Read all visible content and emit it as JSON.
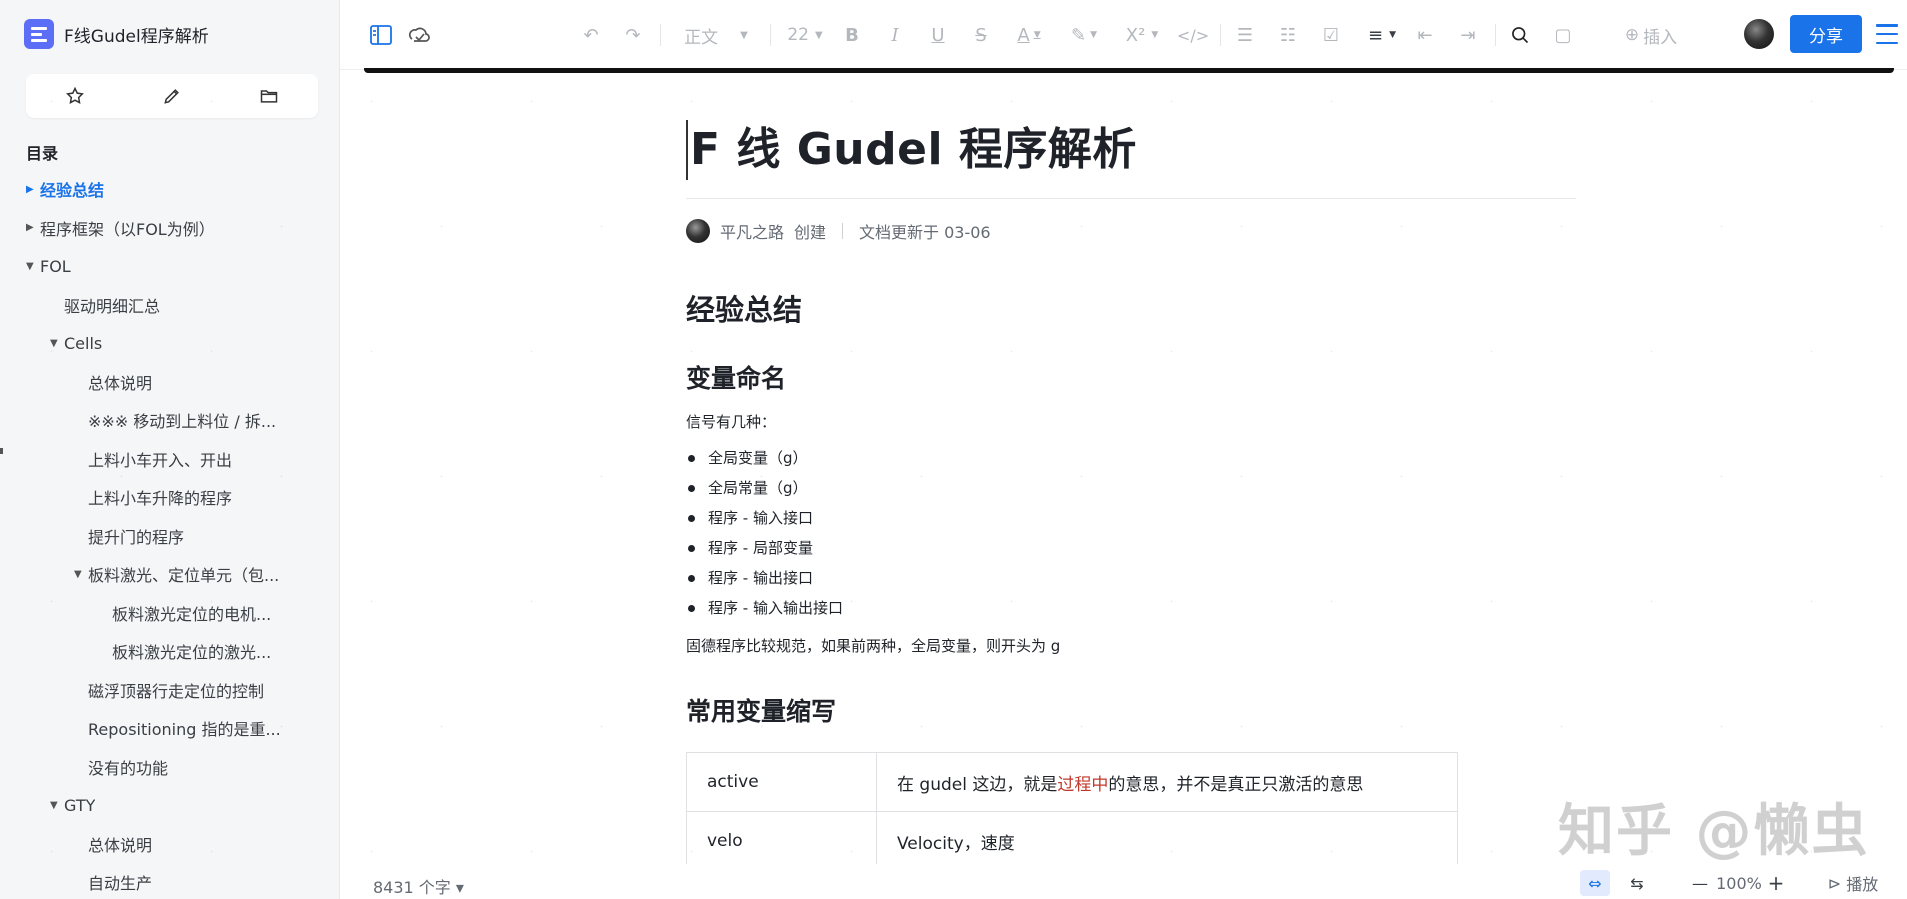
{
  "sidebar": {
    "doc_name": "F线Gudel程序解析",
    "toc_heading": "目录",
    "toc": [
      {
        "label": "经验总结",
        "level": 0,
        "arrow": "▶",
        "active": true
      },
      {
        "label": "程序框架（以FOL为例）",
        "level": 0,
        "arrow": "▶",
        "active": false
      },
      {
        "label": "FOL",
        "level": 0,
        "arrow": "▼",
        "active": false
      },
      {
        "label": "驱动明细汇总",
        "level": 1,
        "arrow": "",
        "active": false
      },
      {
        "label": "Cells",
        "level": 1,
        "arrow": "▼",
        "active": false
      },
      {
        "label": "总体说明",
        "level": 2,
        "arrow": "",
        "active": false
      },
      {
        "label": "※※※ 移动到上料位 / 拆...",
        "level": 2,
        "arrow": "",
        "active": false
      },
      {
        "label": "上料小车开入、开出",
        "level": 2,
        "arrow": "",
        "active": false
      },
      {
        "label": "上料小车升降的程序",
        "level": 2,
        "arrow": "",
        "active": false
      },
      {
        "label": "提升门的程序",
        "level": 2,
        "arrow": "",
        "active": false
      },
      {
        "label": "板料激光、定位单元（包...",
        "level": 2,
        "arrow": "▼",
        "active": false
      },
      {
        "label": "板料激光定位的电机...",
        "level": 3,
        "arrow": "",
        "active": false
      },
      {
        "label": "板料激光定位的激光...",
        "level": 3,
        "arrow": "",
        "active": false
      },
      {
        "label": "磁浮顶器行走定位的控制",
        "level": 2,
        "arrow": "",
        "active": false
      },
      {
        "label": "Repositioning 指的是重...",
        "level": 2,
        "arrow": "",
        "active": false
      },
      {
        "label": "没有的功能",
        "level": 2,
        "arrow": "",
        "active": false
      },
      {
        "label": "GTY",
        "level": 1,
        "arrow": "▼",
        "active": false
      },
      {
        "label": "总体说明",
        "level": 2,
        "arrow": "",
        "active": false
      },
      {
        "label": "自动生产",
        "level": 2,
        "arrow": "",
        "active": false
      }
    ]
  },
  "toolbar": {
    "paragraph_style": "正文",
    "font_size": "22",
    "insert_label": "插入",
    "share_label": "分享"
  },
  "doc": {
    "title": "F 线 Gudel 程序解析",
    "author": "平凡之路",
    "created_label": "创建",
    "updated": "文档更新于 03-06",
    "h2_summary": "经验总结",
    "h3_naming": "变量命名",
    "signals_intro": "信号有几种：",
    "signal_list": [
      "全局变量（g）",
      "全局常量（g）",
      "程序 - 输入接口",
      "程序 - 局部变量",
      "程序 - 输出接口",
      "程序 - 输入输出接口"
    ],
    "naming_note": "固德程序比较规范，如果前两种，全局变量，则开头为 g",
    "h3_abbr": "常用变量缩写",
    "table": [
      {
        "key": "active",
        "desc_prefix": "在 gudel 这边，就是",
        "desc_highlight": "过程中",
        "desc_suffix": "的意思，并不是真正只激活的意思"
      },
      {
        "key": "velo",
        "desc_prefix": "Velocity，速度",
        "desc_highlight": "",
        "desc_suffix": ""
      }
    ]
  },
  "status": {
    "word_count": "8431 个字 ▾",
    "zoom": "100%",
    "play_label": "播放"
  },
  "watermarks": {
    "zhihu": "知乎 @懒虫"
  },
  "colors": {
    "accent": "#1a73e8",
    "highlight_text": "#c0392b",
    "sidebar_bg": "#f5f6f7"
  }
}
